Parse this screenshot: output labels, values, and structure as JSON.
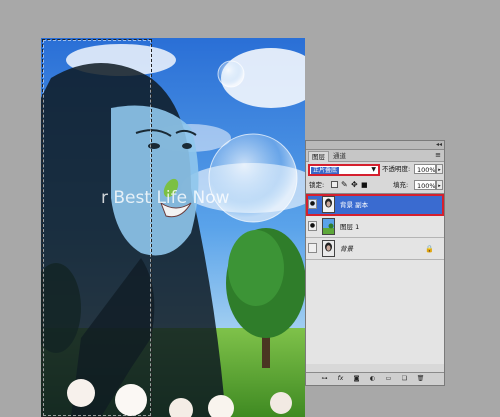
{
  "canvas": {
    "overlay_text": "r Best Life Now"
  },
  "layers_panel": {
    "tabs": [
      {
        "label": "图层",
        "active": true
      },
      {
        "label": "通道",
        "active": false
      }
    ],
    "menu_icon": "panel-menu-icon",
    "blend_mode": "正片叠底",
    "opacity_label": "不透明度:",
    "opacity_value": "100%",
    "lock_label": "锁定:",
    "fill_label": "填充:",
    "fill_value": "100%",
    "layers": [
      {
        "name": "背景 副本",
        "visible": true,
        "selected": true,
        "locked": false
      },
      {
        "name": "图层 1",
        "visible": true,
        "selected": false,
        "locked": false
      },
      {
        "name": "背景",
        "visible": false,
        "selected": false,
        "locked": true
      }
    ],
    "footer_icons": [
      "link-icon",
      "fx-icon",
      "mask-icon",
      "adjustment-icon",
      "group-icon",
      "new-layer-icon",
      "trash-icon"
    ]
  },
  "colors": {
    "selection_blue": "#3a6bd0",
    "highlight_red": "#d5202e"
  }
}
